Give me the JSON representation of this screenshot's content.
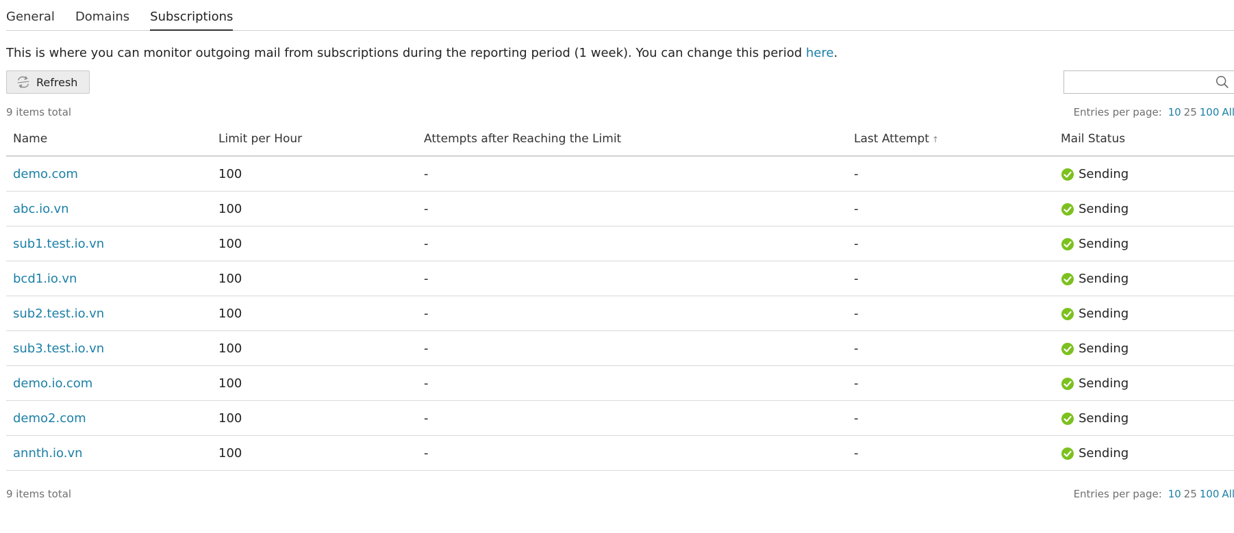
{
  "tabs": [
    {
      "label": "General"
    },
    {
      "label": "Domains"
    },
    {
      "label": "Subscriptions"
    }
  ],
  "hint": {
    "text": "This is where you can monitor outgoing mail from subscriptions during the reporting period (1 week). You can change this period ",
    "link": "here",
    "end": "."
  },
  "toolbar": {
    "refresh_label": "Refresh",
    "search_placeholder": ""
  },
  "list_meta": {
    "total": "9 items total",
    "entries_label": "Entries per page:",
    "entries_options": [
      "10",
      "25",
      "100",
      "All"
    ]
  },
  "table": {
    "headers": [
      "Name",
      "Limit per Hour",
      "Attempts after Reaching the Limit",
      "Last Attempt",
      "Mail Status"
    ],
    "sort_indicator": "↑",
    "rows": [
      {
        "name": "demo.com",
        "limit": "100",
        "attempts": "-",
        "last": "-",
        "status": "Sending"
      },
      {
        "name": "abc.io.vn",
        "limit": "100",
        "attempts": "-",
        "last": "-",
        "status": "Sending"
      },
      {
        "name": "sub1.test.io.vn",
        "limit": "100",
        "attempts": "-",
        "last": "-",
        "status": "Sending"
      },
      {
        "name": "bcd1.io.vn",
        "limit": "100",
        "attempts": "-",
        "last": "-",
        "status": "Sending"
      },
      {
        "name": "sub2.test.io.vn",
        "limit": "100",
        "attempts": "-",
        "last": "-",
        "status": "Sending"
      },
      {
        "name": "sub3.test.io.vn",
        "limit": "100",
        "attempts": "-",
        "last": "-",
        "status": "Sending"
      },
      {
        "name": "demo.io.com",
        "limit": "100",
        "attempts": "-",
        "last": "-",
        "status": "Sending"
      },
      {
        "name": "demo2.com",
        "limit": "100",
        "attempts": "-",
        "last": "-",
        "status": "Sending"
      },
      {
        "name": "annth.io.vn",
        "limit": "100",
        "attempts": "-",
        "last": "-",
        "status": "Sending"
      }
    ]
  },
  "colors": {
    "link": "#1b7fa6",
    "status_ok": "#7cc11f"
  },
  "icons": {
    "refresh": "refresh-icon",
    "search": "search-icon",
    "status": "check-circle-icon"
  }
}
